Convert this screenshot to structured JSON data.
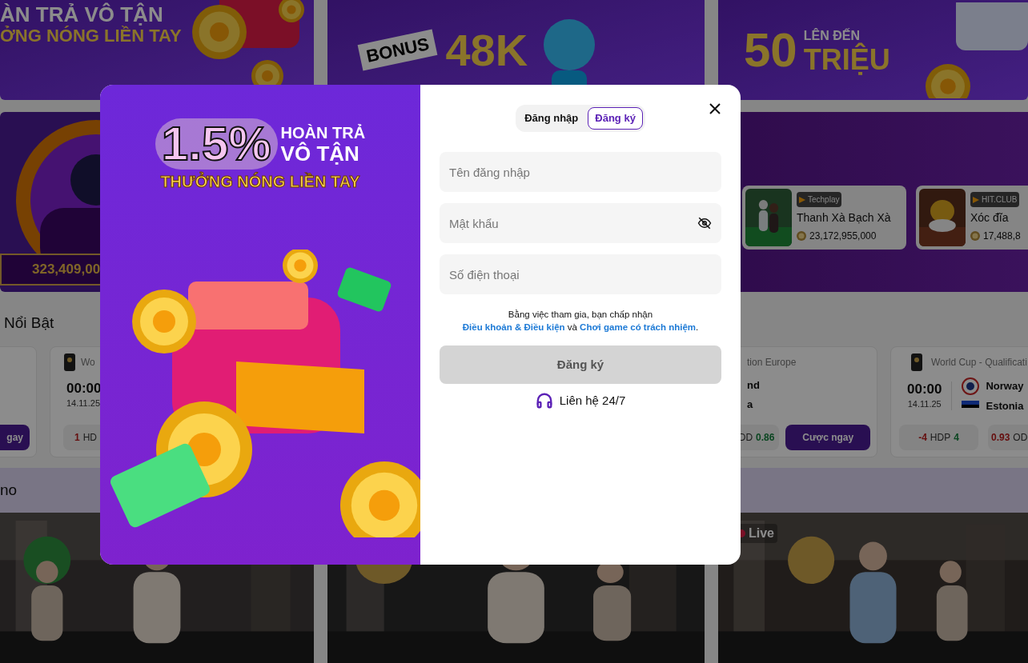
{
  "promo_banners": [
    {
      "kind": "cashback",
      "line_1": "ÀN TRẢ VÔ TẬN",
      "line_2": "ỞNG NÓNG LIỀN TAY"
    },
    {
      "kind": "bonus",
      "label": "BONUS",
      "amount": "48K"
    },
    {
      "kind": "prize",
      "prefix": "LÊN ĐẾN",
      "amount": "50",
      "unit": "TRIỆU"
    }
  ],
  "jackpot_tile": {
    "amount": "323,409,00"
  },
  "game_cards": [
    {
      "provider": "Techplay",
      "name": "Thanh Xà Bạch Xà",
      "amount": "23,172,955,000"
    },
    {
      "provider": "HIT.CLUB",
      "name": "Xóc đĩa",
      "amount": "17,488,8"
    }
  ],
  "featured": {
    "title": "Nổi Bật",
    "matches": [
      {
        "kind": "button_only",
        "button": "gay"
      },
      {
        "kind": "left_part",
        "league": "Wo",
        "time": "00:00",
        "date": "14.11.25",
        "hdp_home": "1",
        "hdp_label": "HD"
      },
      {
        "kind": "right_part",
        "league": "tion Europe",
        "home": "nd",
        "away": "a",
        "odd_label": "DD",
        "odd_away": "0.86",
        "button": "Cược ngay"
      },
      {
        "kind": "full",
        "league": "World Cup - Qualificati",
        "time": "00:00",
        "date": "14.11.25",
        "home": "Norway",
        "away": "Estonia",
        "hdp_home": "-4",
        "hdp_label": "HDP",
        "hdp_away": "4",
        "odd_home": "0.93",
        "odd_label": "OD"
      }
    ]
  },
  "casino": {
    "title": "no",
    "tiles": [
      {
        "kind": "picture"
      },
      {
        "kind": "picture"
      },
      {
        "kind": "picture",
        "badge": "Live"
      }
    ]
  },
  "modal": {
    "promo": {
      "rate": "1.5%",
      "line_1": "HOÀN TRẢ",
      "line_2": "VÔ TẬN",
      "tagline": "THƯỞNG NÓNG LIỀN TAY"
    },
    "tabs": [
      {
        "label": "Đăng nhập",
        "selected": false
      },
      {
        "label": "Đăng ký",
        "selected": true
      }
    ],
    "fields": [
      {
        "kind": "text",
        "placeholder": "Tên đăng nhập"
      },
      {
        "kind": "password",
        "placeholder": "Mật khẩu"
      },
      {
        "kind": "text",
        "placeholder": "Số điện thoại"
      }
    ],
    "terms": {
      "intro": "Bằng việc tham gia, bạn chấp nhận",
      "link_1": "Điều khoản & Điều kiện",
      "joiner": "và",
      "link_2": "Chơi game có trách nhiệm",
      "end": "."
    },
    "submit": {
      "label": "Đăng ký",
      "disabled": true
    },
    "support": "Liên hệ 24/7"
  }
}
